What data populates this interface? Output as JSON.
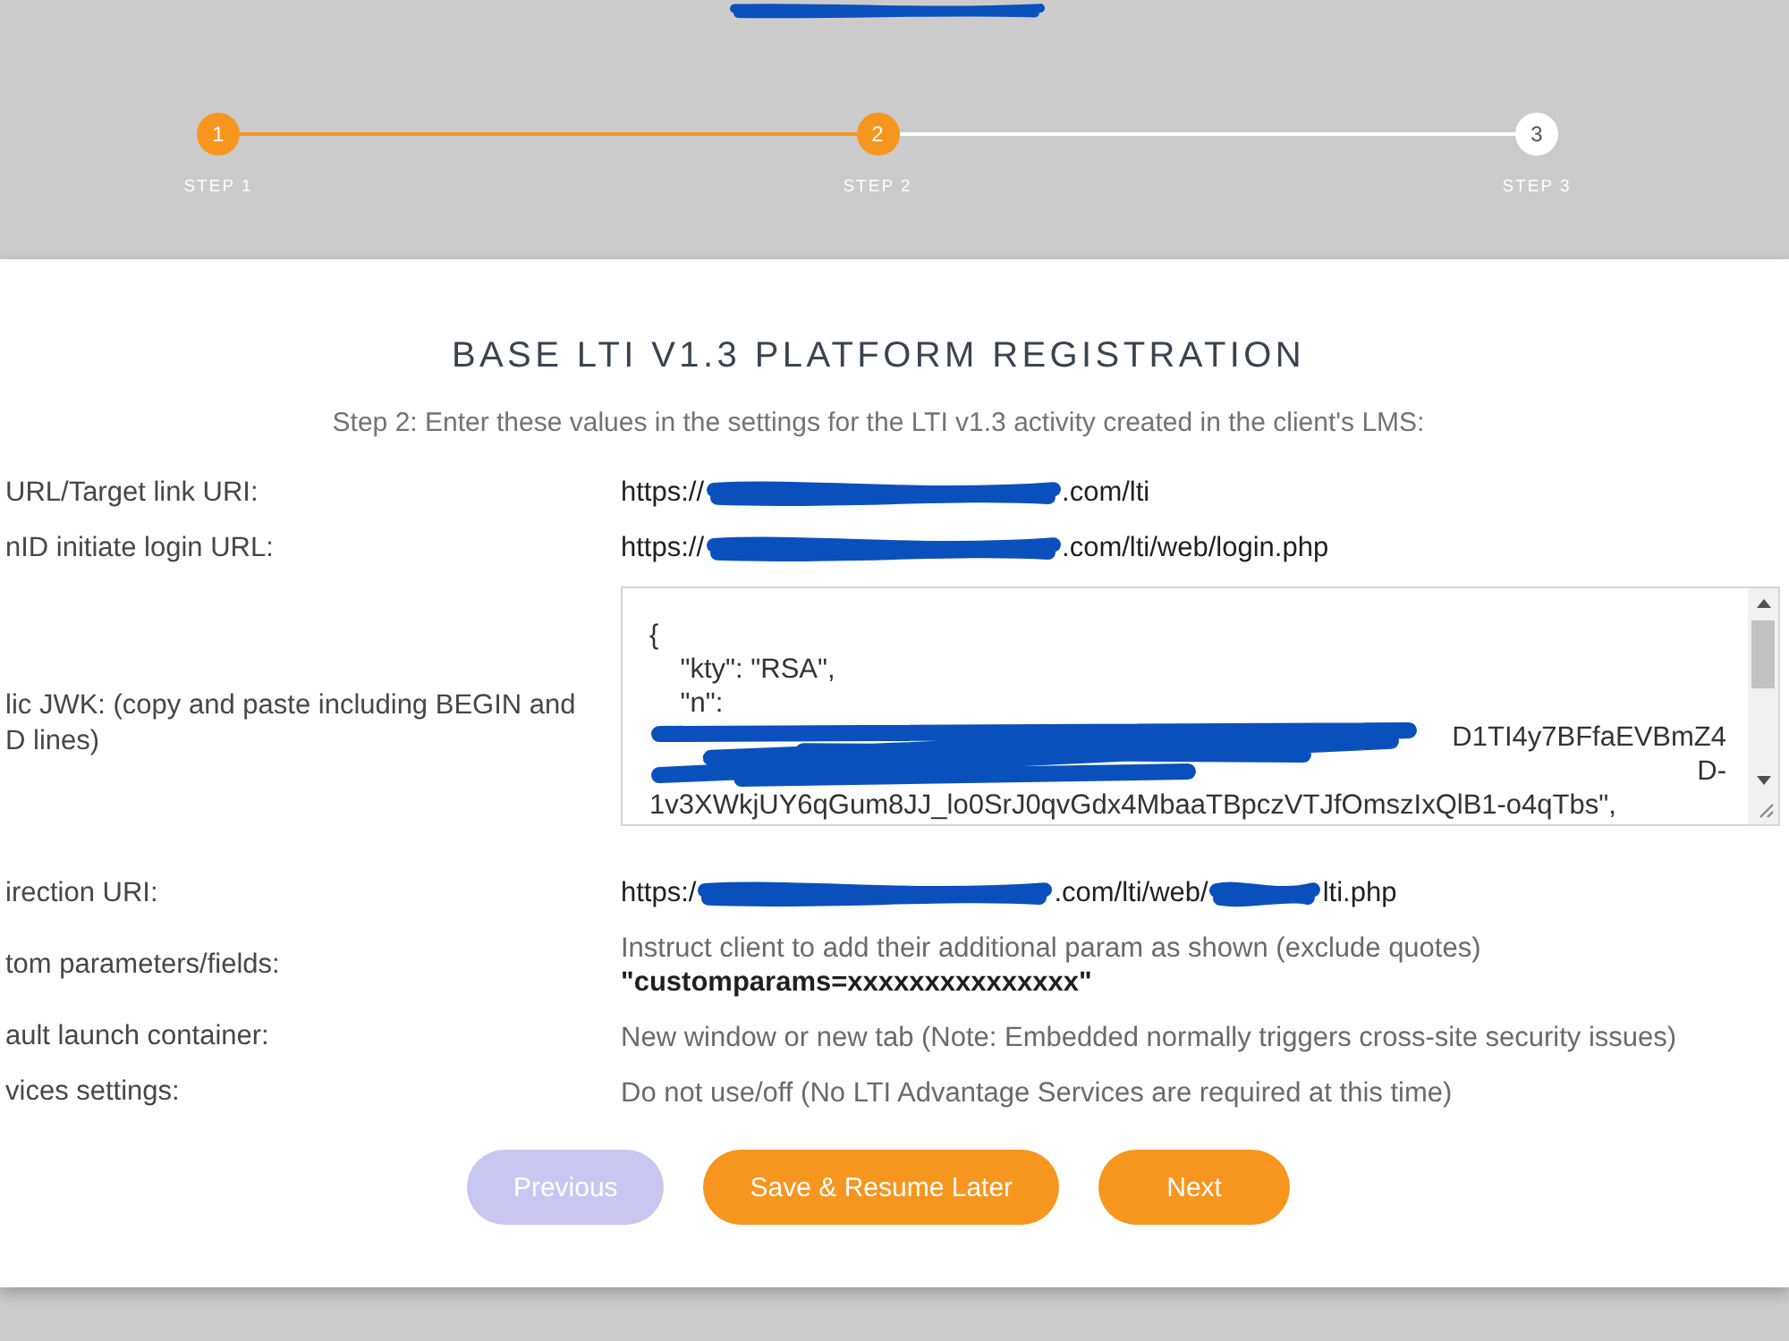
{
  "stepper": {
    "steps": [
      {
        "number": "1",
        "label": "STEP 1",
        "reached": true
      },
      {
        "number": "2",
        "label": "STEP 2",
        "reached": true
      },
      {
        "number": "3",
        "label": "STEP 3",
        "reached": false
      }
    ]
  },
  "form": {
    "title": "BASE LTI V1.3 PLATFORM REGISTRATION",
    "subtitle": "Step 2: Enter these values in the settings for the LTI v1.3 activity created in the client's LMS:",
    "rows": [
      {
        "label_lines": [
          "URL/Target link URI:"
        ],
        "kind": "link",
        "segments": [
          {
            "kind": "text",
            "text": "https://"
          },
          {
            "kind": "redacted"
          },
          {
            "kind": "text",
            "text": ".com/lti"
          }
        ]
      },
      {
        "label_lines": [
          "nID initiate login URL:"
        ],
        "kind": "link",
        "segments": [
          {
            "kind": "text",
            "text": "https://"
          },
          {
            "kind": "redacted"
          },
          {
            "kind": "text",
            "text": ".com/lti/web/login.php"
          }
        ]
      },
      {
        "label_lines": [
          "lic JWK: (copy and paste including BEGIN and",
          "D lines)"
        ],
        "kind": "code",
        "lines": [
          {
            "kind": "text",
            "text": "{"
          },
          {
            "kind": "text",
            "text": "    \"kty\": \"RSA\","
          },
          {
            "kind": "text",
            "text": "    \"n\":"
          },
          {
            "kind": "redacted",
            "tails": [
              "D1TI4y7BFfaEVBmZ4",
              "D-"
            ]
          },
          {
            "kind": "text",
            "text": "1v3XWkjUY6qGum8JJ_lo0SrJ0qvGdx4MbaaTBpczVTJfOmszIxQlB1-o4qTbs\","
          }
        ]
      },
      {
        "label_lines": [
          "irection URI:"
        ],
        "kind": "link",
        "segments": [
          {
            "kind": "text",
            "text": "https:/"
          },
          {
            "kind": "redacted"
          },
          {
            "kind": "text",
            "text": ".com/lti/web/"
          },
          {
            "kind": "redacted"
          },
          {
            "kind": "text",
            "text": "lti.php"
          }
        ]
      },
      {
        "label_lines": [
          "tom parameters/fields:"
        ],
        "kind": "note",
        "text": "Instruct client to add their additional param as shown (exclude quotes)",
        "example": "\"customparams=xxxxxxxxxxxxxxx\""
      },
      {
        "label_lines": [
          "ault launch container:"
        ],
        "kind": "note",
        "text": "New window or new tab (Note: Embedded normally triggers cross-site security issues)"
      },
      {
        "label_lines": [
          "vices settings:"
        ],
        "kind": "note",
        "text": "Do not use/off (No LTI Advantage Services are required at this time)"
      }
    ],
    "buttons": [
      {
        "label": "Previous",
        "disabled": true
      },
      {
        "label": "Save & Resume Later",
        "disabled": false
      },
      {
        "label": "Next",
        "disabled": false
      }
    ]
  }
}
